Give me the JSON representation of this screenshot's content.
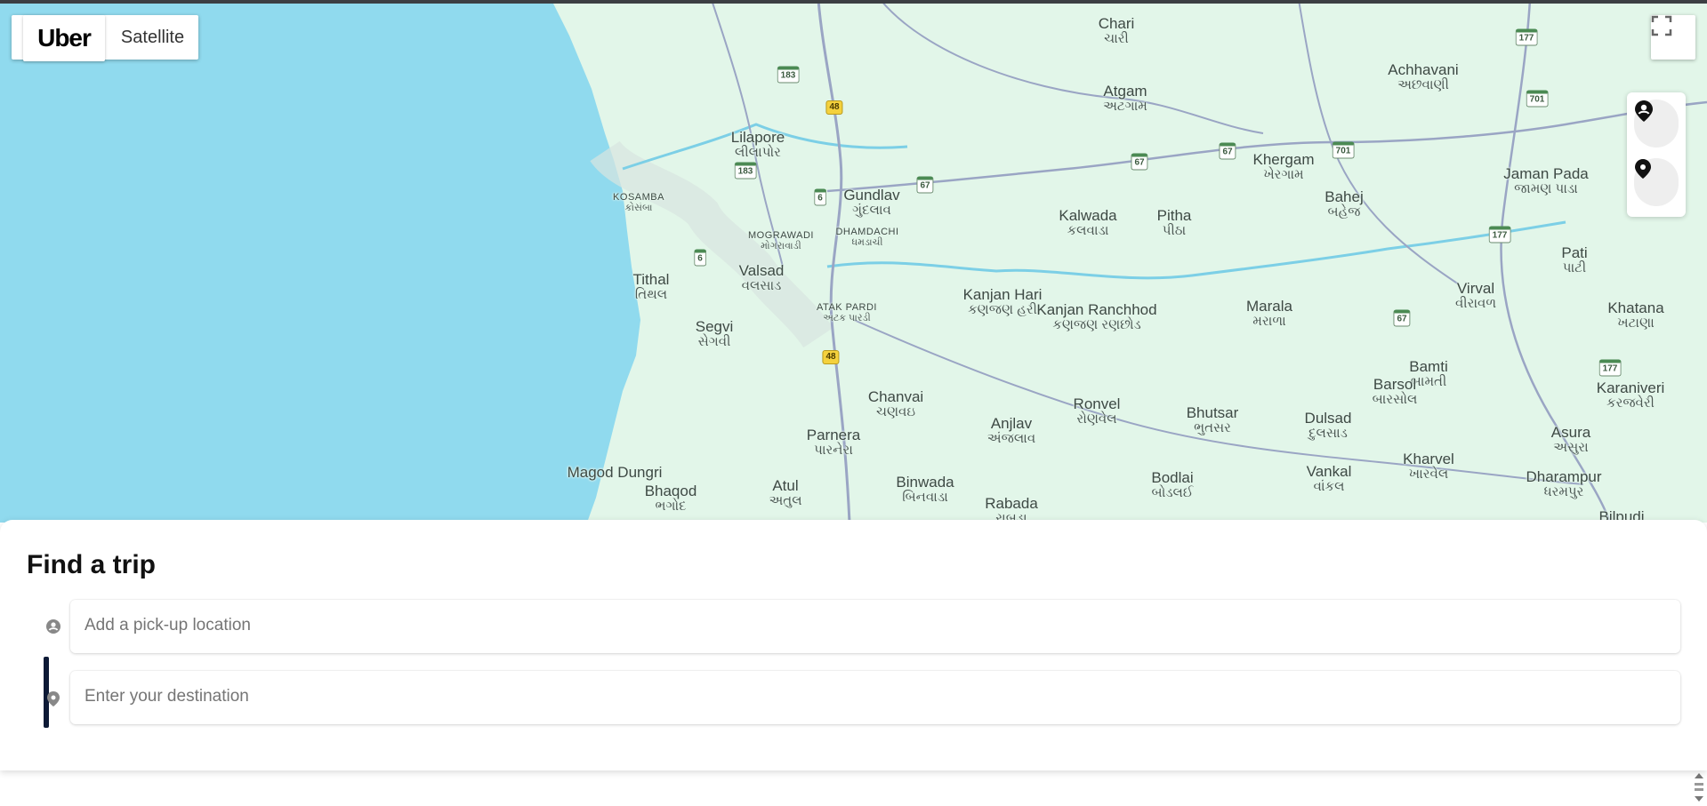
{
  "map": {
    "type_control": {
      "brand_label": "Uber",
      "satellite_label": "Satellite"
    },
    "fullscreen_icon": "fullscreen-icon",
    "location_buttons": [
      "pickup-pin-icon",
      "destination-pin-icon"
    ],
    "colors": {
      "water": "#90daee",
      "land": "#e2f6e9",
      "road": "#9aa5c4",
      "river": "#7ccfe6"
    },
    "places": [
      {
        "en": "Chari",
        "gu": "ચારી"
      },
      {
        "en": "Atgam",
        "gu": "અટગામ"
      },
      {
        "en": "Achhavani",
        "gu": "અછવાણી"
      },
      {
        "en": "Lilapore",
        "gu": "લીલાપોર"
      },
      {
        "en": "Khergam",
        "gu": "ખેરગામ"
      },
      {
        "en": "Jaman Pada",
        "gu": "જામણ પાડા"
      },
      {
        "en": "Gundlav",
        "gu": "ગુંદલાવ"
      },
      {
        "en": "Bahej",
        "gu": "બહેજ"
      },
      {
        "en": "KOSAMBA",
        "gu": "કોસંબા"
      },
      {
        "en": "Kalwada",
        "gu": "કલવાડા"
      },
      {
        "en": "Pitha",
        "gu": "પીઠા"
      },
      {
        "en": "MOGRAWADI",
        "gu": "મોગરાવાડી"
      },
      {
        "en": "DHAMDACHI",
        "gu": "ધમડાચી"
      },
      {
        "en": "Pati",
        "gu": "પાટી"
      },
      {
        "en": "Valsad",
        "gu": "વલસાડ"
      },
      {
        "en": "Tithal",
        "gu": "તિથલ"
      },
      {
        "en": "Kanjan Hari",
        "gu": "કણજણ હરી"
      },
      {
        "en": "Virval",
        "gu": "વીરાવળ"
      },
      {
        "en": "ATAK PARDI",
        "gu": "અટક પારડી"
      },
      {
        "en": "Kanjan Ranchhod",
        "gu": "કણજણ રણછોડ"
      },
      {
        "en": "Marala",
        "gu": "મરાળા"
      },
      {
        "en": "Khatana",
        "gu": "ખટાણા"
      },
      {
        "en": "Segvi",
        "gu": "સેગવી"
      },
      {
        "en": "Bamti",
        "gu": "બામતી"
      },
      {
        "en": "Barsol",
        "gu": "બારસોલ"
      },
      {
        "en": "Karaniveri",
        "gu": "કરજવેરી"
      },
      {
        "en": "Chanvai",
        "gu": "ચણવઇ"
      },
      {
        "en": "Ronvel",
        "gu": "રોણવેલ"
      },
      {
        "en": "Bhutsar",
        "gu": "ભુતસર"
      },
      {
        "en": "Anjlav",
        "gu": "અંજલાવ"
      },
      {
        "en": "Dulsad",
        "gu": "દુલસાડ"
      },
      {
        "en": "Asura",
        "gu": "અસુરા"
      },
      {
        "en": "Parnera",
        "gu": "પારનેરા"
      },
      {
        "en": "Kharvel",
        "gu": "ખારવેલ"
      },
      {
        "en": "Magod Dungri",
        "gu": ""
      },
      {
        "en": "Vankal",
        "gu": "વાંકલ"
      },
      {
        "en": "Bodlai",
        "gu": "બોડલઈ"
      },
      {
        "en": "Dharampur",
        "gu": "ધરમપુર"
      },
      {
        "en": "Bhaqod",
        "gu": "ભગોદ"
      },
      {
        "en": "Atul",
        "gu": "અતુલ"
      },
      {
        "en": "Binwada",
        "gu": "બિનવાડા"
      },
      {
        "en": "Rabada",
        "gu": "રાબડા"
      },
      {
        "en": "Bilpudi",
        "gu": ""
      }
    ],
    "shields": [
      "183",
      "48",
      "183",
      "6",
      "67",
      "67",
      "67",
      "701",
      "177",
      "701",
      "177",
      "6",
      "48",
      "67",
      "177"
    ]
  },
  "trip": {
    "title": "Find a trip",
    "pickup_placeholder": "Add a pick-up location",
    "pickup_icon": "pickup-pin-icon",
    "destination_placeholder": "Enter your destination",
    "destination_icon": "destination-pin-icon"
  }
}
